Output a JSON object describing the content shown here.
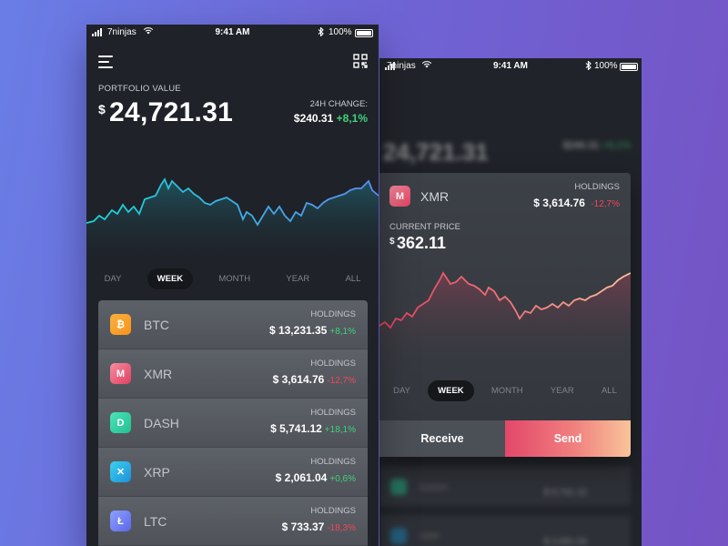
{
  "status_bar": {
    "carrier": "7ninjas",
    "time": "9:41 AM",
    "battery": "100%"
  },
  "portfolio": {
    "label": "PORTFOLIO VALUE",
    "currency": "$",
    "value": "24,721.31",
    "change_label": "24H CHANGE:",
    "change_value": "$240.31",
    "change_percent": "+8,1%"
  },
  "ranges": [
    "DAY",
    "WEEK",
    "MONTH",
    "YEAR",
    "ALL"
  ],
  "active_range": "WEEK",
  "coins": [
    {
      "symbol": "BTC",
      "icon": "bitcoin-icon",
      "glyph": "₿",
      "holdings_label": "HOLDINGS",
      "holdings": "$ 13,231.35",
      "change": "+8,1%",
      "trend": "up"
    },
    {
      "symbol": "XMR",
      "icon": "monero-icon",
      "glyph": "M",
      "holdings_label": "HOLDINGS",
      "holdings": "$ 3,614.76",
      "change": "-12,7%",
      "trend": "down"
    },
    {
      "symbol": "DASH",
      "icon": "dash-icon",
      "glyph": "D",
      "holdings_label": "HOLDINGS",
      "holdings": "$ 5,741.12",
      "change": "+18,1%",
      "trend": "up"
    },
    {
      "symbol": "XRP",
      "icon": "ripple-icon",
      "glyph": "✕",
      "holdings_label": "HOLDINGS",
      "holdings": "$ 2,061.04",
      "change": "+0,6%",
      "trend": "up"
    },
    {
      "symbol": "LTC",
      "icon": "litecoin-icon",
      "glyph": "Ł",
      "holdings_label": "HOLDINGS",
      "holdings": "$ 733.37",
      "change": "-18,3%",
      "trend": "down"
    }
  ],
  "detail": {
    "symbol": "XMR",
    "glyph": "M",
    "holdings_label": "HOLDINGS",
    "holdings": "$ 3,614.76",
    "change": "-12,7%",
    "price_label": "CURRENT PRICE",
    "price_currency": "$",
    "price": "362.11",
    "receive_label": "Receive",
    "send_label": "Send"
  },
  "colors": {
    "background_start": "#6a7de6",
    "background_end": "#7553c4",
    "phone_bg": "#1f2228",
    "positive": "#3fd27a",
    "negative": "#f0475b",
    "btc": "#f7931a",
    "xmr": "#e0405f",
    "dash": "#2ed3a0",
    "xrp": "#27a2db",
    "ltc": "#6f7cf2",
    "chart_start": "#1bd4d4",
    "chart_end": "#5b8cf0",
    "detail_chart_start": "#e0405f",
    "detail_chart_end": "#f9c49a"
  }
}
